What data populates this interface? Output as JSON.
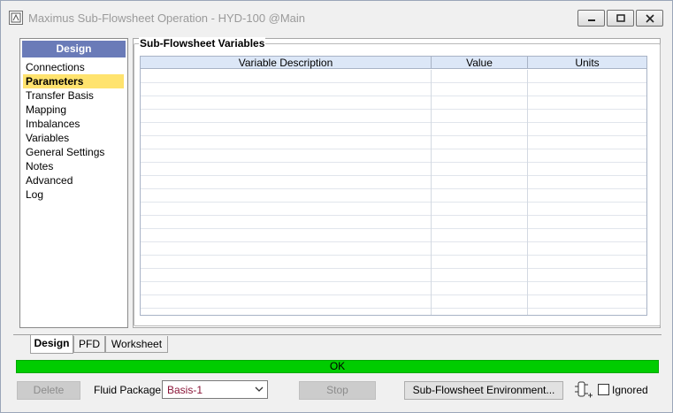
{
  "window": {
    "title": "Maximus Sub-Flowsheet Operation - HYD-100 @Main"
  },
  "nav": {
    "header": "Design",
    "items": [
      {
        "label": "Connections"
      },
      {
        "label": "Parameters",
        "selected": true
      },
      {
        "label": "Transfer Basis"
      },
      {
        "label": "Mapping"
      },
      {
        "label": "Imbalances"
      },
      {
        "label": "Variables"
      },
      {
        "label": "General Settings"
      },
      {
        "label": "Notes"
      },
      {
        "label": "Advanced"
      },
      {
        "label": "Log"
      }
    ]
  },
  "main": {
    "group_title": "Sub-Flowsheet Variables",
    "grid": {
      "columns": [
        "Variable Description",
        "Value",
        "Units"
      ],
      "rows": []
    }
  },
  "tabs": [
    {
      "label": "Design",
      "active": true
    },
    {
      "label": "PFD"
    },
    {
      "label": "Worksheet"
    }
  ],
  "status": {
    "text": "OK",
    "color": "#00cc00"
  },
  "footer": {
    "delete_label": "Delete",
    "fluid_package_label": "Fluid Package",
    "fluid_package_value": "Basis-1",
    "stop_label": "Stop",
    "env_label": "Sub-Flowsheet Environment...",
    "ignored_label": "Ignored",
    "ignored_checked": false
  },
  "colors": {
    "nav_header": "#6a7bb8",
    "nav_selected": "#ffe36e",
    "grid_header": "#dce7f7",
    "fluid_package_text": "#8a1538"
  },
  "icons": {
    "app": "app-icon",
    "minimize": "minimize-icon",
    "maximize": "maximize-icon",
    "close": "close-icon",
    "dropdown": "chevron-down-icon",
    "simulation": "column-simulation-icon"
  }
}
